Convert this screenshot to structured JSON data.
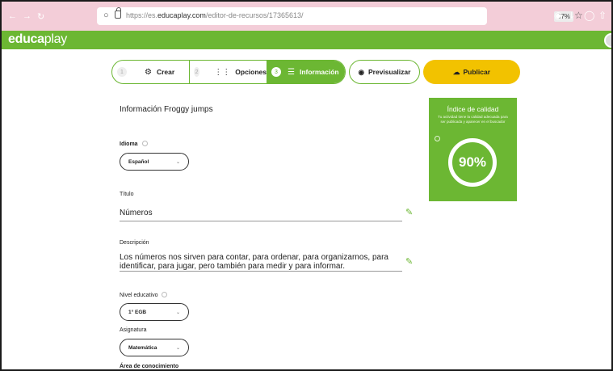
{
  "browser": {
    "url_prefix": "https://es.",
    "url_domain": "educaplay.com",
    "url_path": "/editor-de-recursos/17365613/",
    "zoom": "67%"
  },
  "app": {
    "logo_prefix": "educa",
    "logo_suffix": "play"
  },
  "steps": [
    {
      "number": "1",
      "label": "Crear"
    },
    {
      "number": "2",
      "label": "Opciones"
    },
    {
      "number": "3",
      "label": "Información"
    }
  ],
  "actions": {
    "preview_label": "Previsualizar",
    "publish_label": "Publicar"
  },
  "form": {
    "heading": "Información Froggy jumps",
    "language_label": "Idioma",
    "language_value": "Español",
    "title_label": "Título",
    "title_value": "Números",
    "description_label": "Descripción",
    "description_value": "Los números nos sirven para contar, para ordenar, para organizarnos, para identificar, para jugar, pero también para medir y para informar.",
    "level_label": "Nivel educativo",
    "level_value": "1° EGB",
    "subject_label": "Asignatura",
    "subject_value": "Matemática",
    "area_label": "Área de conocimiento"
  },
  "quality": {
    "title": "Índice de calidad",
    "description": "Tu actividad tiene la calidad adecuada para ser publicada y aparecer en el buscador",
    "score": "90%",
    "score_fraction": 0.9
  },
  "colors": {
    "green": "#6cb733",
    "yellow": "#f2c200",
    "browser_bar": "#f3cdd8"
  }
}
